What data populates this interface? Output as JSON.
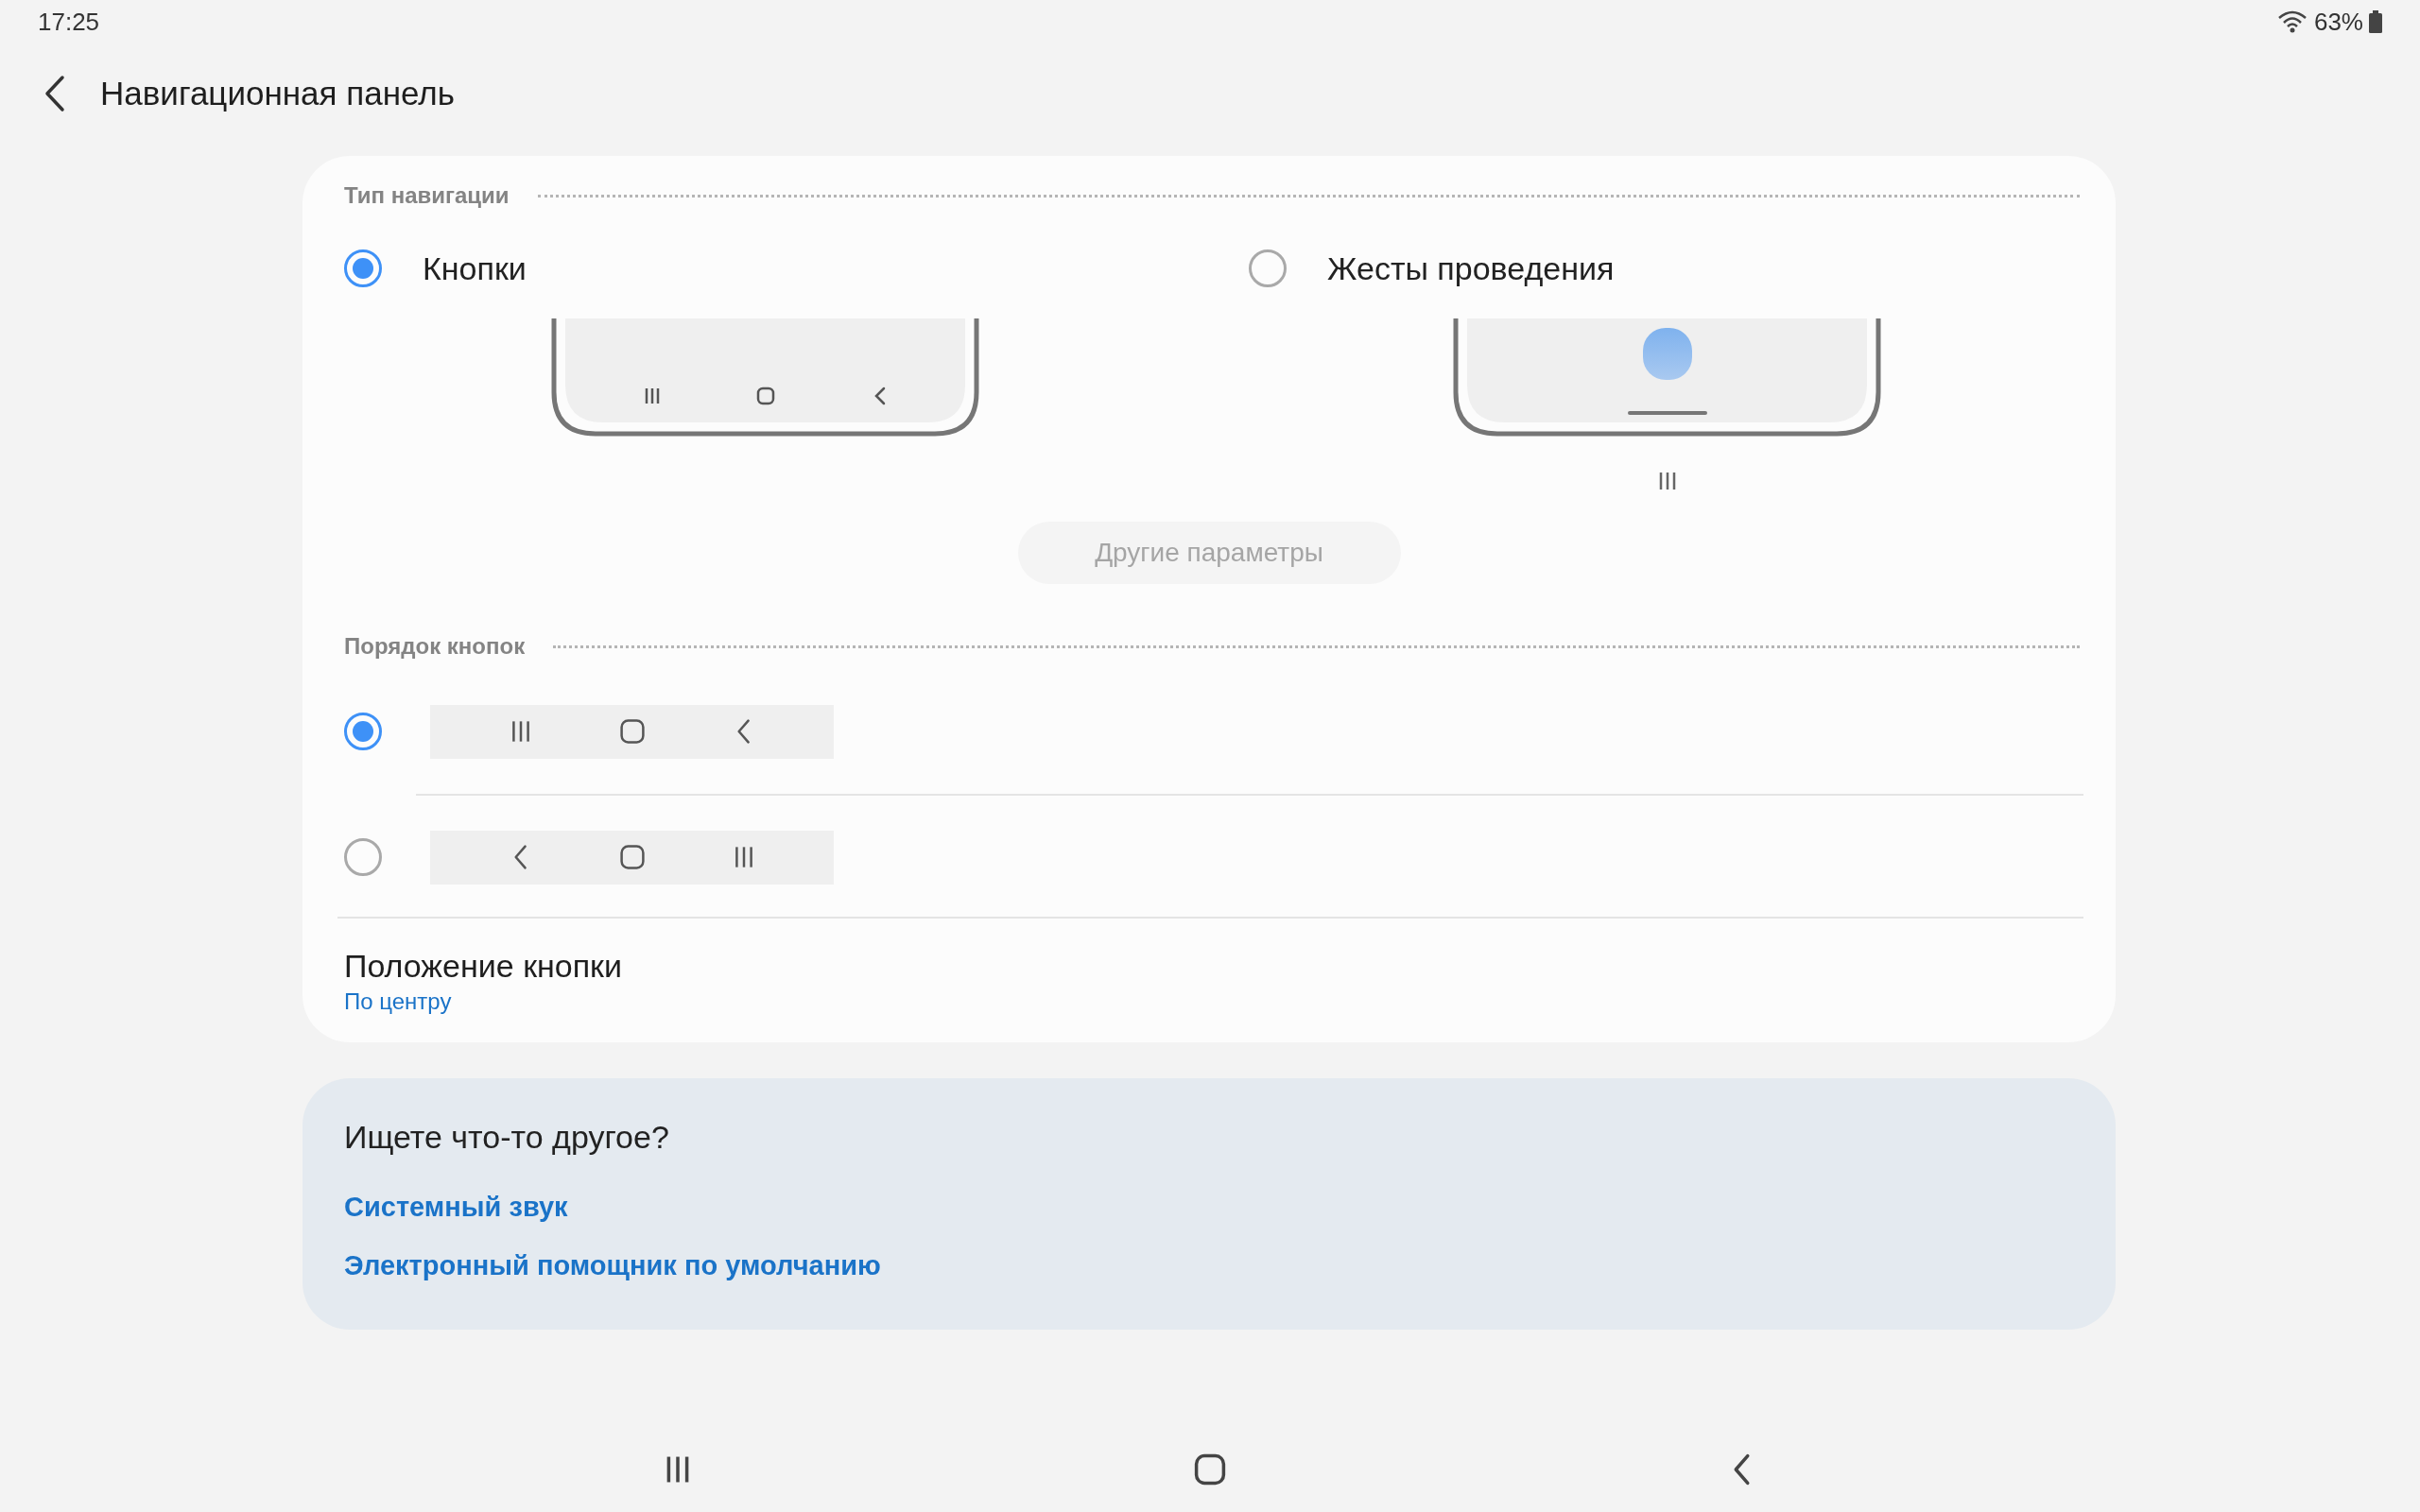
{
  "status_bar": {
    "time": "17:25",
    "battery": "63%"
  },
  "header": {
    "title": "Навигационная панель"
  },
  "navigation_type": {
    "heading": "Тип навигации",
    "options": [
      {
        "kind": "buttons",
        "label": "Кнопки",
        "selected": true
      },
      {
        "kind": "gestures",
        "label": "Жесты проведения",
        "selected": false
      }
    ],
    "more_button": {
      "label": "Другие параметры",
      "disabled": true
    }
  },
  "button_order": {
    "heading": "Порядок кнопок",
    "options": [
      {
        "order": [
          {
            "kind": "recents"
          },
          {
            "kind": "home"
          },
          {
            "kind": "back"
          }
        ],
        "selected": true
      },
      {
        "order": [
          {
            "kind": "back"
          },
          {
            "kind": "home"
          },
          {
            "kind": "recents"
          }
        ],
        "selected": false
      }
    ]
  },
  "button_position": {
    "title": "Положение кнопки",
    "value": "По центру"
  },
  "suggestions": {
    "title": "Ищете что-то другое?",
    "links": [
      "Системный звук",
      "Электронный помощник по умолчанию"
    ]
  },
  "system_nav": [
    {
      "kind": "recents"
    },
    {
      "kind": "home"
    },
    {
      "kind": "back"
    }
  ]
}
